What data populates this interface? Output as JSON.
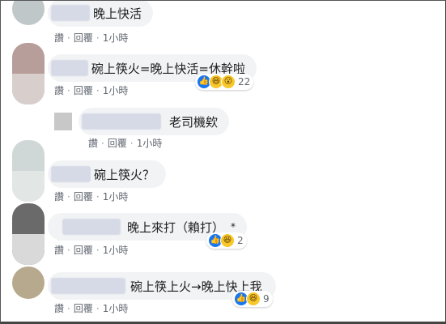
{
  "comments": [
    {
      "text": "晚上快活",
      "actions": [
        "讚",
        "回覆",
        "1小時"
      ]
    },
    {
      "text": "碗上筷火=晚上快活=休幹啦",
      "actions": [
        "讚",
        "回覆",
        "1小時"
      ],
      "reaction_count": "22",
      "reactions": [
        "like-icon",
        "haha-icon",
        "wow-icon"
      ]
    },
    {
      "text": "老司機欸",
      "actions": [
        "讚",
        "回覆",
        "1小時"
      ],
      "is_reply": true
    },
    {
      "text": "碗上筷火？",
      "actions": [
        "讚",
        "回覆",
        "1小時"
      ]
    },
    {
      "text": "晚上來打（賴打）",
      "asterisk": "*",
      "actions": [
        "讚",
        "回覆",
        "1小時"
      ],
      "reaction_count": "2",
      "reactions": [
        "like-icon",
        "haha-icon"
      ]
    },
    {
      "text": "碗上筷上火→晚上快上我",
      "actions": [
        "讚",
        "回覆",
        "1小時"
      ],
      "reaction_count": "9",
      "reactions": [
        "like-icon",
        "haha-icon"
      ]
    }
  ],
  "colors": {
    "bubble": "#f2f3f5",
    "action_text": "#606770",
    "like": "#1877f2",
    "haha": "#f7c72b"
  }
}
